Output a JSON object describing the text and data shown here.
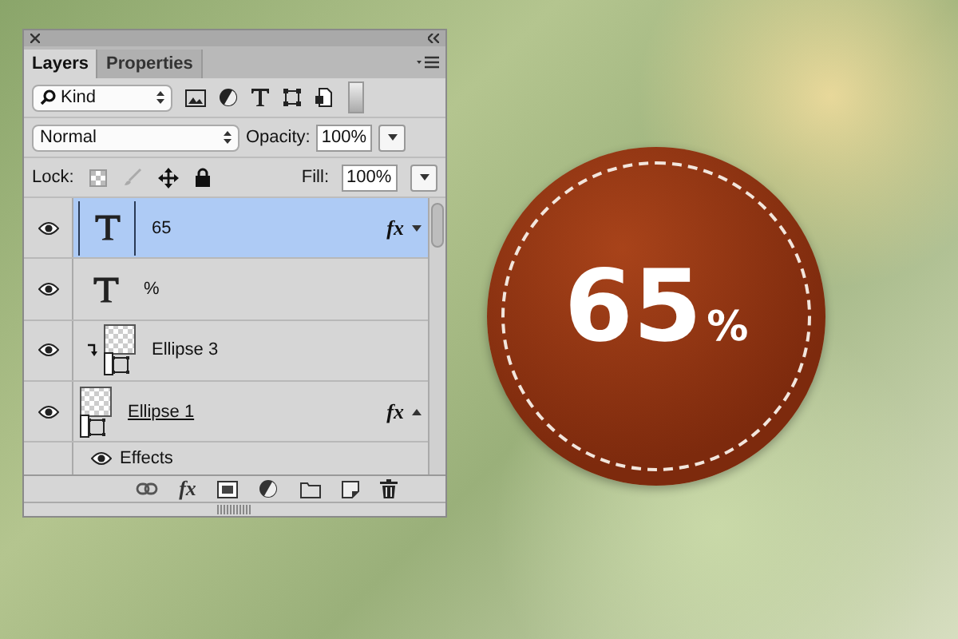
{
  "tabs": [
    {
      "label": "Layers",
      "selected": true
    },
    {
      "label": "Properties",
      "selected": false
    }
  ],
  "filter": {
    "value": "Kind"
  },
  "blend_mode": {
    "value": "Normal"
  },
  "opacity": {
    "label": "Opacity:",
    "value": "100%"
  },
  "lock": {
    "label": "Lock:"
  },
  "fill": {
    "label": "Fill:",
    "value": "100%"
  },
  "layers": [
    {
      "kind": "text",
      "name": "65",
      "selected": true,
      "fx": "fx",
      "clipped": false
    },
    {
      "kind": "text",
      "name": "%",
      "selected": false,
      "clipped": false
    },
    {
      "kind": "shape",
      "name": "Ellipse 3",
      "selected": false,
      "clipped": true
    },
    {
      "kind": "shape",
      "name": "Ellipse 1",
      "selected": false,
      "fx": "fx",
      "clipped": false,
      "children": [
        {
          "label": "Effects"
        }
      ]
    }
  ],
  "bottom_toolbar": {
    "fx_label": "fx"
  },
  "badge": {
    "value": "65",
    "unit": "%"
  }
}
